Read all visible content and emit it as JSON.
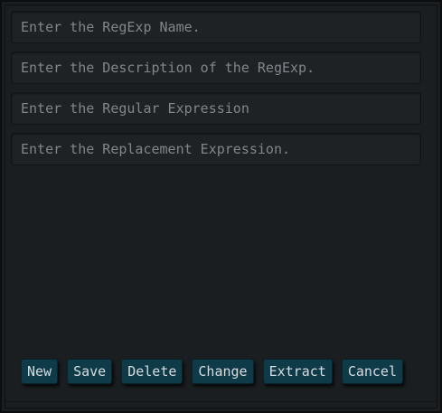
{
  "form": {
    "name_placeholder": "Enter the RegExp Name.",
    "description_placeholder": "Enter the Description of the RegExp.",
    "regex_placeholder": "Enter the Regular Expression",
    "replacement_placeholder": "Enter the Replacement Expression."
  },
  "buttons": {
    "new": "New",
    "save": "Save",
    "delete": "Delete",
    "change": "Change",
    "extract": "Extract",
    "cancel": "Cancel"
  },
  "colors": {
    "background": "#1b1e21",
    "field_background": "#1f2225",
    "button_background": "#0f3a48",
    "button_text": "#d6dbde",
    "placeholder_text": "#80868a"
  }
}
